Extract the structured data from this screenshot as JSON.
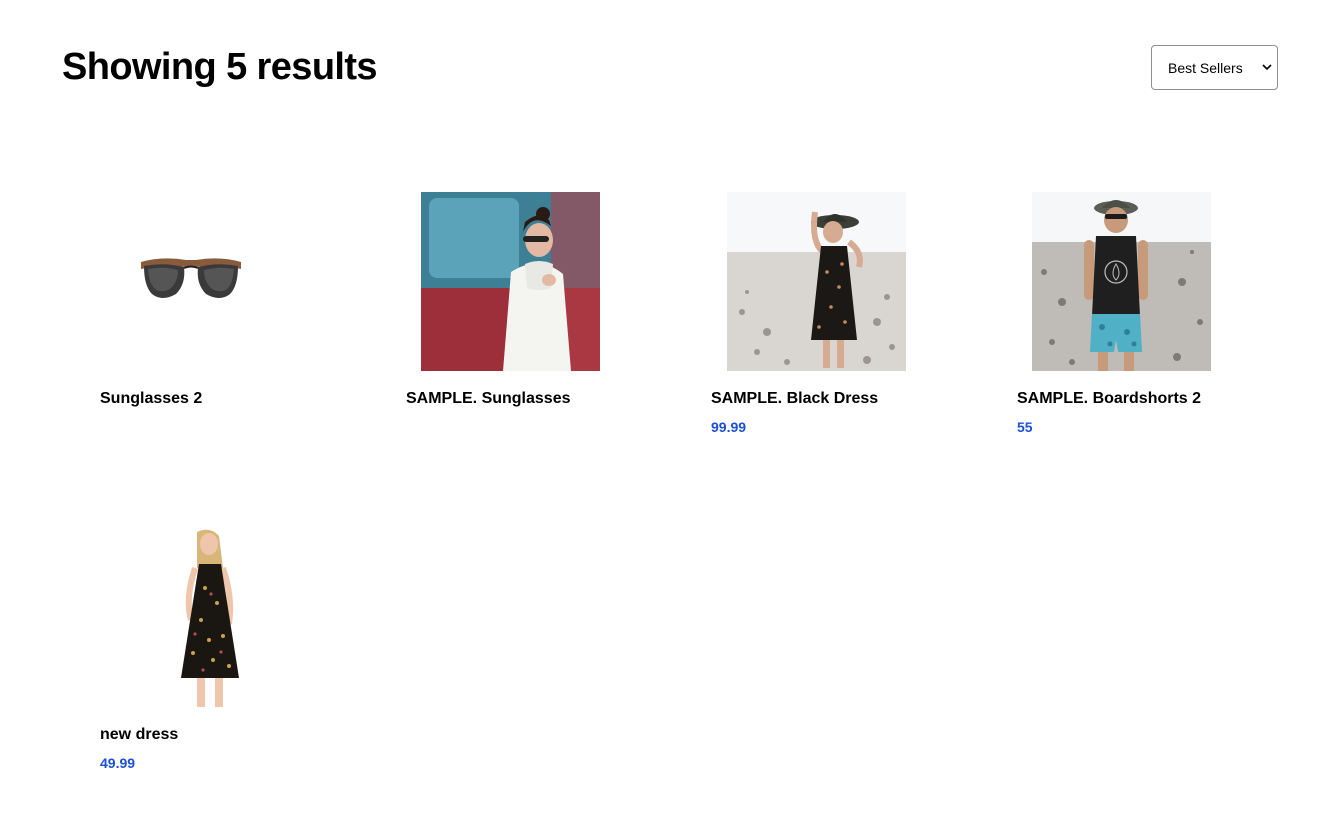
{
  "header": {
    "title": "Showing 5 results"
  },
  "sort": {
    "selected": "Best Sellers"
  },
  "colors": {
    "price": "#1a4fd6",
    "text": "#000000",
    "background": "#ffffff"
  },
  "products": [
    {
      "name": "Sunglasses 2",
      "price": "",
      "image": "sunglasses-product"
    },
    {
      "name": "SAMPLE. Sunglasses",
      "price": "",
      "image": "woman-white-dress-car"
    },
    {
      "name": "SAMPLE. Black Dress",
      "price": "99.99",
      "image": "woman-black-dress-beach"
    },
    {
      "name": "SAMPLE. Boardshorts 2",
      "price": "55",
      "image": "man-tank-top-beach"
    },
    {
      "name": "new dress",
      "price": "49.99",
      "image": "woman-floral-dress"
    }
  ]
}
